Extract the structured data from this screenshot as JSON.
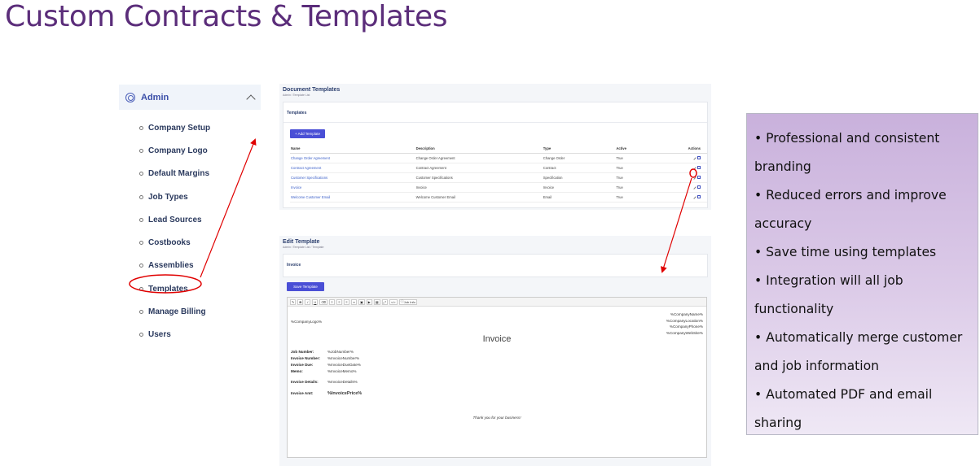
{
  "slide": {
    "title": "Custom Contracts & Templates"
  },
  "sidebar": {
    "header": {
      "label": "Admin",
      "icon": "gear-icon",
      "chevron": "chevron-up-icon"
    },
    "items": [
      {
        "label": "Company Setup"
      },
      {
        "label": "Company Logo"
      },
      {
        "label": "Default Margins"
      },
      {
        "label": "Job Types"
      },
      {
        "label": "Lead Sources"
      },
      {
        "label": "Costbooks"
      },
      {
        "label": "Assemblies"
      },
      {
        "label": "Templates"
      },
      {
        "label": "Manage Billing"
      },
      {
        "label": "Users"
      }
    ]
  },
  "document_templates": {
    "title": "Document Templates",
    "breadcrumb": "Admin  /  Template List",
    "card_title": "Templates",
    "add_button": "+ Add Template",
    "columns": {
      "name": "Name",
      "description": "Description",
      "type": "Type",
      "active": "Active",
      "actions": "Actions"
    },
    "rows": [
      {
        "name": "Change Order Agreement",
        "description": "Change Order Agreement",
        "type": "Change Order",
        "active": "True"
      },
      {
        "name": "Contract Agreement",
        "description": "Contract Agreement",
        "type": "Contract",
        "active": "True"
      },
      {
        "name": "Customer Specifications",
        "description": "Customer Specifications",
        "type": "Specification",
        "active": "True"
      },
      {
        "name": "Invoice",
        "description": "Invoice",
        "type": "Invoice",
        "active": "True"
      },
      {
        "name": "Welcome Customer Email",
        "description": "Welcome Customer Email",
        "type": "Email",
        "active": "True"
      }
    ]
  },
  "edit_template": {
    "title": "Edit Template",
    "breadcrumb": "Admin  /  Template List  /  Template",
    "name": "Invoice",
    "save_button": "Save Template",
    "toolbar": {
      "bold": "B",
      "italic": "I",
      "underline": "U",
      "insert_tag": "Job Info"
    },
    "document": {
      "company_name": "%CompanyName%",
      "company_location": "%CompanyLocation%",
      "company_phone": "%CompanyPhone%",
      "company_website": "%CompanyWebSite%",
      "company_logo": "%CompanyLogo%",
      "heading": "Invoice",
      "fields": [
        {
          "label": "Job Number:",
          "value": "%JobNumber%"
        },
        {
          "label": "Invoice Number:",
          "value": "%InvoiceNumber%"
        },
        {
          "label": "Invoice Due:",
          "value": "%InvoiceDueDate%"
        },
        {
          "label": "Memo:",
          "value": "%InvoiceMemo%"
        },
        {
          "label": "Invoice Details:",
          "value": "%InvoiceDetails%"
        },
        {
          "label": "Invoice Amt:",
          "value": "%InvoicePrice%"
        }
      ],
      "footer": "Thank you for your business!"
    }
  },
  "benefits": [
    "• Professional and consistent branding",
    "• Reduced errors and improve accuracy",
    "• Save time using templates",
    "• Integration will all job functionality",
    "• Automatically merge customer and job information",
    "• Automated PDF and email sharing"
  ],
  "colors": {
    "title": "#5b2d7a",
    "accent": "#4a4fd6",
    "annotation": "#e00000"
  }
}
